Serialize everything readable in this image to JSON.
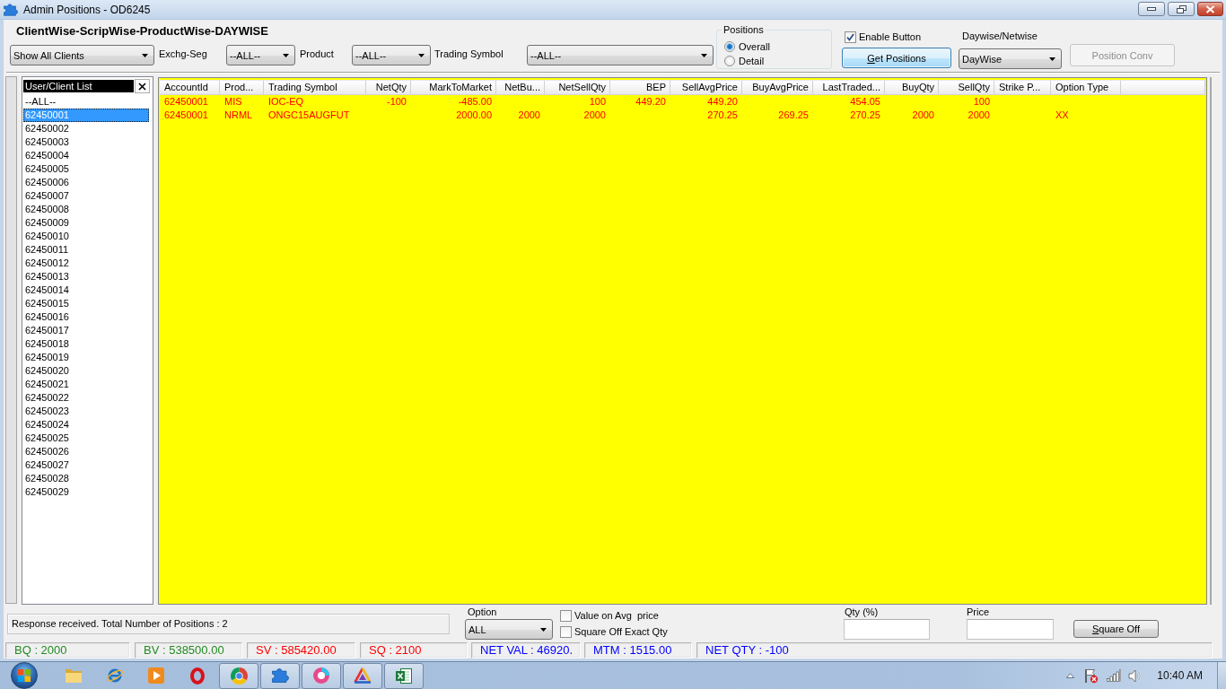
{
  "window": {
    "title": "Admin Positions - OD6245"
  },
  "heading": "ClientWise-ScripWise-ProductWise-DAYWISE",
  "filters": [
    {
      "value": "Show All Clients"
    },
    {
      "label": "Exchg-Seg",
      "value": "--ALL--"
    },
    {
      "label": "Product",
      "value": "--ALL--"
    },
    {
      "label": "Trading Symbol",
      "value": "--ALL--"
    }
  ],
  "positions": {
    "legend": "Positions",
    "options": [
      {
        "label": "Overall",
        "selected": true
      },
      {
        "label": "Detail",
        "selected": false
      }
    ]
  },
  "enable_button": {
    "label": "Enable Button",
    "checked": true
  },
  "get_positions_button": {
    "label": "Get Positions",
    "focused": true
  },
  "daywise_netwise": {
    "label": "Daywise/Netwise",
    "value": "DayWise"
  },
  "position_conv_button": {
    "label": "Position Conv",
    "disabled": true
  },
  "client_list": {
    "title": "User/Client List",
    "items": [
      {
        "label": "--ALL--",
        "selected": false
      },
      {
        "label": "62450001",
        "selected": true
      },
      {
        "label": "62450002",
        "selected": false
      },
      {
        "label": "62450003",
        "selected": false
      },
      {
        "label": "62450004",
        "selected": false
      },
      {
        "label": "62450005",
        "selected": false
      },
      {
        "label": "62450006",
        "selected": false
      },
      {
        "label": "62450007",
        "selected": false
      },
      {
        "label": "62450008",
        "selected": false
      },
      {
        "label": "62450009",
        "selected": false
      },
      {
        "label": "62450010",
        "selected": false
      },
      {
        "label": "62450011",
        "selected": false
      },
      {
        "label": "62450012",
        "selected": false
      },
      {
        "label": "62450013",
        "selected": false
      },
      {
        "label": "62450014",
        "selected": false
      },
      {
        "label": "62450015",
        "selected": false
      },
      {
        "label": "62450016",
        "selected": false
      },
      {
        "label": "62450017",
        "selected": false
      },
      {
        "label": "62450018",
        "selected": false
      },
      {
        "label": "62450019",
        "selected": false
      },
      {
        "label": "62450020",
        "selected": false
      },
      {
        "label": "62450021",
        "selected": false
      },
      {
        "label": "62450022",
        "selected": false
      },
      {
        "label": "62450023",
        "selected": false
      },
      {
        "label": "62450024",
        "selected": false
      },
      {
        "label": "62450025",
        "selected": false
      },
      {
        "label": "62450026",
        "selected": false
      },
      {
        "label": "62450027",
        "selected": false
      },
      {
        "label": "62450028",
        "selected": false
      },
      {
        "label": "62450029",
        "selected": false
      }
    ]
  },
  "table": {
    "columns": [
      {
        "label": "AccountId",
        "kind": "text"
      },
      {
        "label": "Prod...",
        "kind": "text"
      },
      {
        "label": "Trading Symbol",
        "kind": "text"
      },
      {
        "label": "NetQty",
        "kind": "number"
      },
      {
        "label": "MarkToMarket",
        "kind": "number"
      },
      {
        "label": "NetBu...",
        "kind": "number"
      },
      {
        "label": "NetSellQty",
        "kind": "number"
      },
      {
        "label": "BEP",
        "kind": "number"
      },
      {
        "label": "SellAvgPrice",
        "kind": "number"
      },
      {
        "label": "BuyAvgPrice",
        "kind": "number"
      },
      {
        "label": "LastTraded...",
        "kind": "number"
      },
      {
        "label": "BuyQty",
        "kind": "number"
      },
      {
        "label": "SellQty",
        "kind": "number"
      },
      {
        "label": "Strike P...",
        "kind": "text"
      },
      {
        "label": "Option Type",
        "kind": "text"
      }
    ],
    "rows": [
      [
        "62450001",
        "MIS",
        "IOC-EQ",
        "-100",
        "-485.00",
        null,
        "100",
        "449.20",
        "449.20",
        null,
        "454.05",
        null,
        "100",
        null,
        null
      ],
      [
        "62450001",
        "NRML",
        "ONGC15AUGFUT",
        null,
        "2000.00",
        "2000",
        "2000",
        null,
        "270.25",
        "269.25",
        "270.25",
        "2000",
        "2000",
        null,
        "XX"
      ]
    ]
  },
  "bottom": {
    "status_message": "Response received. Total Number of Positions : 2",
    "option": {
      "label": "Option",
      "value": "ALL"
    },
    "checkboxes": [
      {
        "label": "Value on Avg  price",
        "checked": false
      },
      {
        "label": "Square Off Exact Qty",
        "checked": false
      }
    ],
    "qty": {
      "label": "Qty (%)"
    },
    "price": {
      "label": "Price"
    },
    "square_off_button": {
      "label": "Square Off"
    }
  },
  "status_bar": [
    {
      "text": "BQ : 2000",
      "color": "#228b22"
    },
    {
      "text": "BV : 538500.00",
      "color": "#228b22"
    },
    {
      "text": "SV : 585420.00",
      "color": "#ff0000"
    },
    {
      "text": "SQ : 2100",
      "color": "#ff0000"
    },
    {
      "text": "NET VAL : 46920.",
      "color": "#0000ff"
    },
    {
      "text": "MTM : 1515.00",
      "color": "#0000ff"
    },
    {
      "text": "NET QTY : -100",
      "color": "#0000ff"
    }
  ],
  "taskbar": {
    "apps": [
      {
        "running": false
      },
      {
        "running": false
      },
      {
        "running": false
      },
      {
        "running": false
      },
      {
        "running": true
      },
      {
        "running": true
      },
      {
        "running": true
      },
      {
        "running": true
      },
      {
        "running": true
      }
    ],
    "clock": "10:40 AM"
  }
}
